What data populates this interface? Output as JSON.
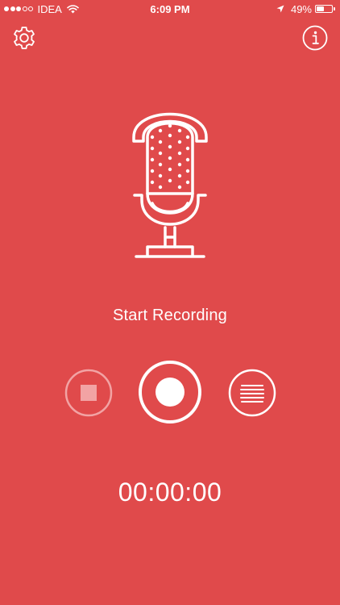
{
  "status_bar": {
    "carrier": "IDEA",
    "time": "6:09 PM",
    "battery_text": "49%",
    "battery_level": 0.49,
    "signal_strength": 3,
    "signal_max": 5
  },
  "icons": {
    "settings": "gear-icon",
    "info": "info-icon",
    "microphone": "microphone-icon",
    "stop": "stop-icon",
    "record": "record-icon",
    "list": "list-icon"
  },
  "main": {
    "start_label": "Start Recording",
    "timer": "00:00:00"
  },
  "colors": {
    "background": "#E04A4B",
    "foreground": "#FFFFFF",
    "disabled": "#F2A3A4"
  }
}
